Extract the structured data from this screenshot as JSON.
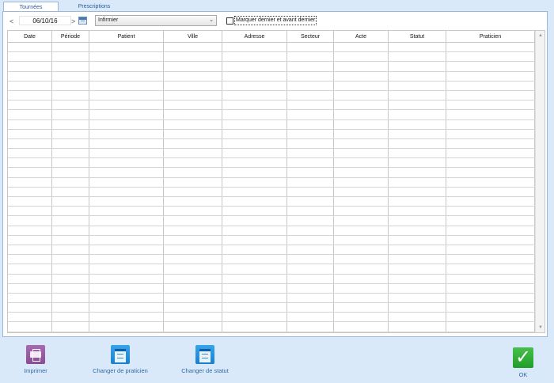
{
  "tabs": [
    {
      "label": "Tournées",
      "active": true
    },
    {
      "label": "Prescriptions",
      "active": false
    }
  ],
  "toolbar": {
    "prev_label": "<",
    "next_label": ">",
    "date_value": "06/10/16",
    "calendar_icon": "calendar-icon",
    "select_value": "Infirmier",
    "select_chevron": "⌄",
    "checkbox_label": "Marquer dernier et avant dernier",
    "checkbox_checked": false
  },
  "grid": {
    "columns": [
      "Date",
      "Période",
      "Patient",
      "Ville",
      "Adresse",
      "Secteur",
      "Acte",
      "Statut",
      "Praticien"
    ],
    "row_count": 30,
    "scroll_up": "▲",
    "scroll_down": "▼"
  },
  "footer": {
    "print_label": "Imprimer",
    "print_icon": "printer-icon",
    "change_practitioner_label": "Changer de praticien",
    "change_status_label": "Changer de statut",
    "ok_label": "OK",
    "ok_glyph": "✓"
  },
  "colors": {
    "background": "#d9e9f9",
    "accent": "#2f6aa8",
    "ok_green": "#2ea534",
    "print_purple": "#9a5ba3",
    "calendar_blue": "#1e88d8"
  }
}
